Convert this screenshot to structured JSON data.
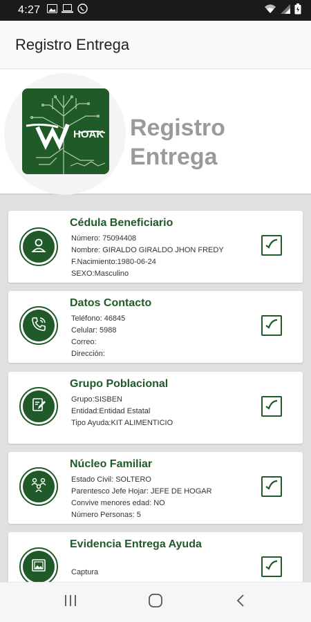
{
  "status_bar": {
    "time": "4:27",
    "icons": [
      "image-icon",
      "laptop-icon",
      "whatsapp-icon",
      "wifi-icon",
      "signal-icon",
      "battery-icon"
    ]
  },
  "app_bar": {
    "title": "Registro Entrega"
  },
  "header": {
    "logo_text": "HOAK",
    "logo_letter": "W",
    "title_line1": "Registro",
    "title_line2": "Entrega"
  },
  "cards": [
    {
      "title": "Cédula Beneficiario",
      "icon": "person-icon",
      "lines": [
        "Número: 75094408",
        "Nombre: GIRALDO GIRALDO JHON FREDY",
        "F.Nacimiento:1980-06-24",
        "SEXO:Masculino"
      ],
      "checked": true
    },
    {
      "title": "Datos Contacto",
      "icon": "phone-icon",
      "lines": [
        "Teléfono: 46845",
        "Celular: 5988",
        "Correo:",
        "Dirección:"
      ],
      "checked": true
    },
    {
      "title": "Grupo Poblacional",
      "icon": "edit-document-icon",
      "lines": [
        "Grupo:SISBEN",
        "Entidad:Entidad Estatal",
        "Tipo Ayuda:KIT ALIMENTICIO"
      ],
      "checked": true
    },
    {
      "title": "Núcleo Familiar",
      "icon": "family-icon",
      "lines": [
        "Estado Civil: SOLTERO",
        "Parentesco Jefe Hojar: JEFE DE HOGAR",
        "Convive menores edad: NO",
        "Número Personas: 5"
      ],
      "checked": true
    },
    {
      "title": "Evidencia Entrega Ayuda",
      "icon": "photo-icon",
      "lines": [
        "",
        "Captura"
      ],
      "checked": true
    }
  ],
  "colors": {
    "primary_green": "#1f5a28",
    "header_title_gray": "#9a9a9a",
    "background": "#e0e0e0"
  },
  "nav_bar": {
    "buttons": [
      "recents-icon",
      "home-icon",
      "back-icon"
    ]
  }
}
